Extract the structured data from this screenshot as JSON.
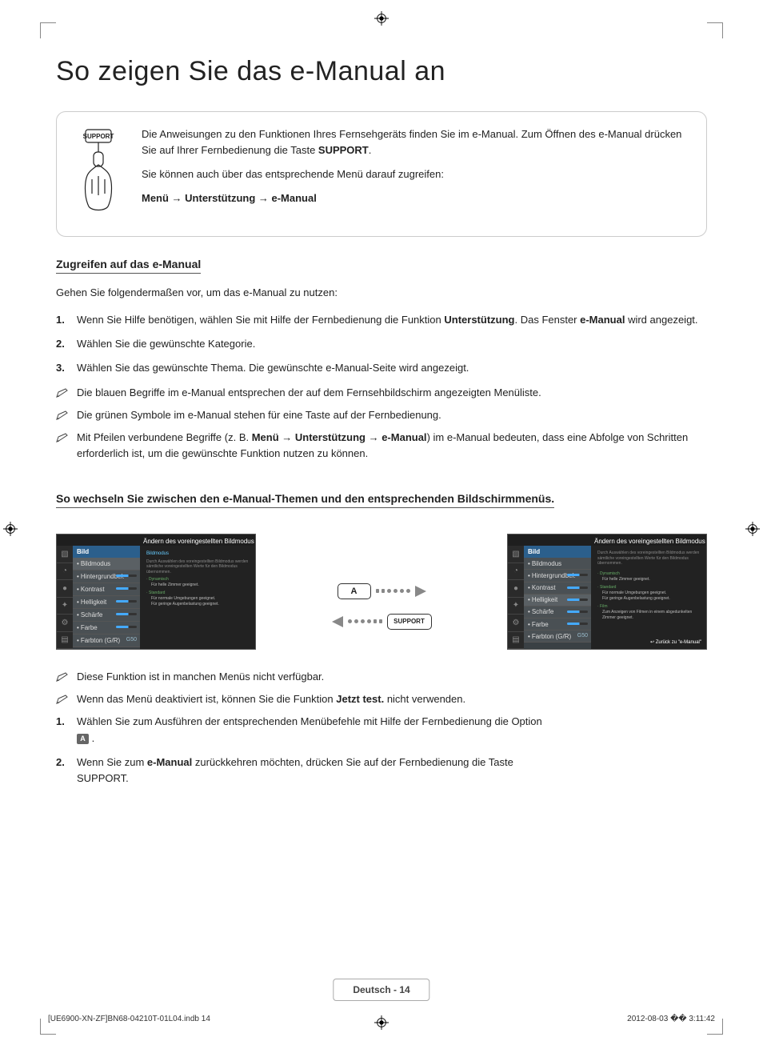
{
  "title": "So zeigen Sie das e-Manual an",
  "remote_button_label": "SUPPORT",
  "intro": {
    "p1_part1": "Die Anweisungen zu den Funktionen Ihres Fernsehgeräts finden Sie im e-Manual. Zum Öffnen des e-Manual drücken Sie auf Ihrer Fernbedienung die Taste ",
    "p1_bold": "SUPPORT",
    "p1_part2": ".",
    "p2": "Sie können auch über das entsprechende Menü darauf zugreifen:",
    "p3": "Menü → Unterstützung → e-Manual"
  },
  "section1_head": "Zugreifen auf das e-Manual",
  "section1_intro": "Gehen Sie folgendermaßen vor, um das e-Manual zu nutzen:",
  "steps1": [
    {
      "n": "1.",
      "pre": "Wenn Sie Hilfe benötigen, wählen Sie mit Hilfe der Fernbedienung die Funktion ",
      "b1": "Unterstützung",
      "mid": ". Das Fenster ",
      "b2": "e-Manual",
      "post": " wird angezeigt."
    },
    {
      "n": "2.",
      "pre": "Wählen Sie die gewünschte Kategorie.",
      "b1": "",
      "mid": "",
      "b2": "",
      "post": ""
    },
    {
      "n": "3.",
      "pre": "Wählen Sie das gewünschte Thema. Die gewünschte e-Manual-Seite wird angezeigt.",
      "b1": "",
      "mid": "",
      "b2": "",
      "post": ""
    }
  ],
  "notes1": [
    "Die blauen Begriffe im e-Manual entsprechen der auf dem Fernsehbildschirm angezeigten Menüliste.",
    "Die grünen Symbole im e-Manual stehen für eine Taste auf der Fernbedienung."
  ],
  "note_arrow_pre": "Mit Pfeilen verbundene Begriffe (z. B. ",
  "note_arrow_bold": "Menü → Unterstützung → e-Manual",
  "note_arrow_post": ") im e-Manual bedeuten, dass eine Abfolge von Schritten erforderlich ist, um die gewünschte Funktion nutzen zu können.",
  "section2_head": "So wechseln Sie zwischen den e-Manual-Themen und den entsprechenden Bildschirmmenüs.",
  "mock": {
    "panel_title": "Ändern des voreingestellten Bildmodus",
    "menu_head": "Bild",
    "items": [
      {
        "label": "Bildmodus",
        "val": ""
      },
      {
        "label": "Hintergrundbel.",
        "val": ""
      },
      {
        "label": "Kontrast",
        "val": ""
      },
      {
        "label": "Helligkeit",
        "val": ""
      },
      {
        "label": "Schärfe",
        "val": ""
      },
      {
        "label": "Farbe",
        "val": ""
      },
      {
        "label": "Farbton (G/R)",
        "val": "G50"
      }
    ],
    "right_footer": "↩ Zurück zu \"e-Manual\""
  },
  "arrow_btn_a": "A",
  "arrow_btn_support": "SUPPORT",
  "notes2": [
    "Diese Funktion ist in manchen Menüs nicht verfügbar."
  ],
  "note2b_pre": "Wenn das Menü deaktiviert ist, können Sie die Funktion ",
  "note2b_bold": "Jetzt test.",
  "note2b_post": " nicht verwenden.",
  "steps2": [
    {
      "n": "1.",
      "text": "Wählen Sie zum Ausführen der entsprechenden Menübefehle mit Hilfe der Fernbedienung die Option"
    },
    {
      "n": "2.",
      "pre": "Wenn Sie zum ",
      "b1": "e-Manual",
      "mid": " zurückkehren möchten, drücken Sie auf der Fernbedienung die Taste ",
      "b2": "SUPPORT",
      "post": "."
    }
  ],
  "footer_center": "Deutsch - 14",
  "footer_left": "[UE6900-XN-ZF]BN68-04210T-01L04.indb   14",
  "footer_right": "2012-08-03   �� 3:11:42"
}
